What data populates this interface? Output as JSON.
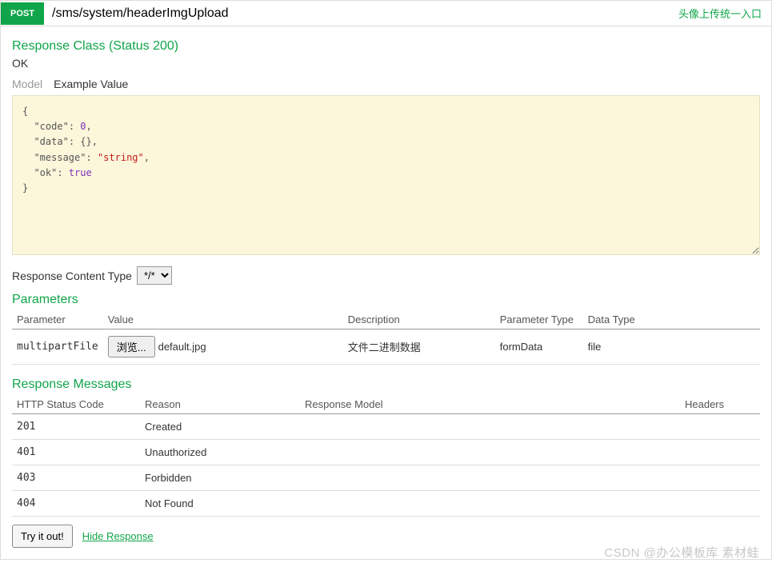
{
  "operation": {
    "method": "POST",
    "path": "/sms/system/headerImgUpload",
    "summary": "头像上传统一入口"
  },
  "response_class": {
    "title": "Response Class (Status 200)",
    "status_text": "OK"
  },
  "tabs": {
    "model": "Model",
    "example": "Example Value"
  },
  "example_json": {
    "code": 0,
    "data": {},
    "message": "string",
    "ok": true
  },
  "content_type": {
    "label": "Response Content Type",
    "selected": "*/*",
    "options": [
      "*/*"
    ]
  },
  "parameters": {
    "title": "Parameters",
    "headers": [
      "Parameter",
      "Value",
      "Description",
      "Parameter Type",
      "Data Type"
    ],
    "rows": [
      {
        "name": "multipartFile",
        "browse_label": "浏览...",
        "file_name": "default.jpg",
        "description": "文件二进制数据",
        "param_type": "formData",
        "data_type": "file"
      }
    ]
  },
  "response_messages": {
    "title": "Response Messages",
    "headers": [
      "HTTP Status Code",
      "Reason",
      "Response Model",
      "Headers"
    ],
    "rows": [
      {
        "code": "201",
        "reason": "Created"
      },
      {
        "code": "401",
        "reason": "Unauthorized"
      },
      {
        "code": "403",
        "reason": "Forbidden"
      },
      {
        "code": "404",
        "reason": "Not Found"
      }
    ]
  },
  "actions": {
    "try_label": "Try it out!",
    "hide_label": "Hide Response"
  },
  "watermark": "CSDN @办公模板库 素材蛙"
}
